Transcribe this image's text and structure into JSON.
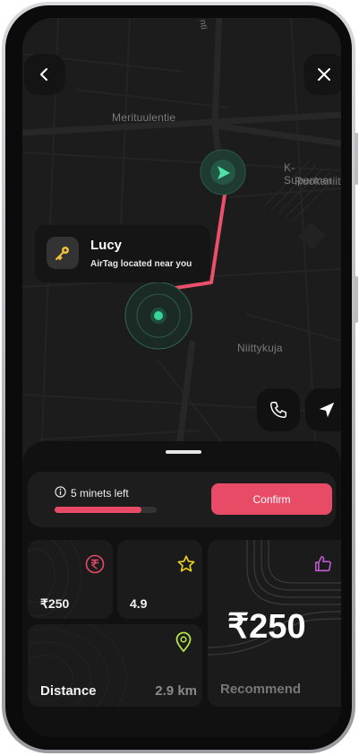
{
  "map": {
    "streets": [
      "Merituulentie",
      "K-Supermar",
      "Ruokaniitt",
      "Niittykuja",
      "nti"
    ]
  },
  "nav": {
    "back_icon": "chevron-left-icon",
    "close_icon": "close-icon"
  },
  "tracker": {
    "name": "Lucy",
    "subtitle": "AirTag located near you",
    "icon": "key-icon"
  },
  "actions": {
    "call_icon": "phone-icon",
    "navigate_icon": "navigation-arrow-icon"
  },
  "status": {
    "time_left": "5 minets left",
    "progress": 0.85,
    "confirm_label": "Confirm"
  },
  "tiles": {
    "price": {
      "value": "₹250",
      "icon": "rupee-circle-icon",
      "icon_color": "#e74b66"
    },
    "rating": {
      "value": "4.9",
      "icon": "star-icon",
      "icon_color": "#e8d21d"
    },
    "distance": {
      "label": "Distance",
      "value": "2.9 km",
      "icon": "location-pin-icon",
      "icon_color": "#b6e34a"
    },
    "recommend": {
      "price": "₹250",
      "label": "Recommend",
      "icon": "thumbs-up-icon",
      "icon_color": "#c45bd6"
    }
  },
  "colors": {
    "accent": "#e74b66",
    "route": "#ea4f6b",
    "location_marker": "#36d39a"
  }
}
